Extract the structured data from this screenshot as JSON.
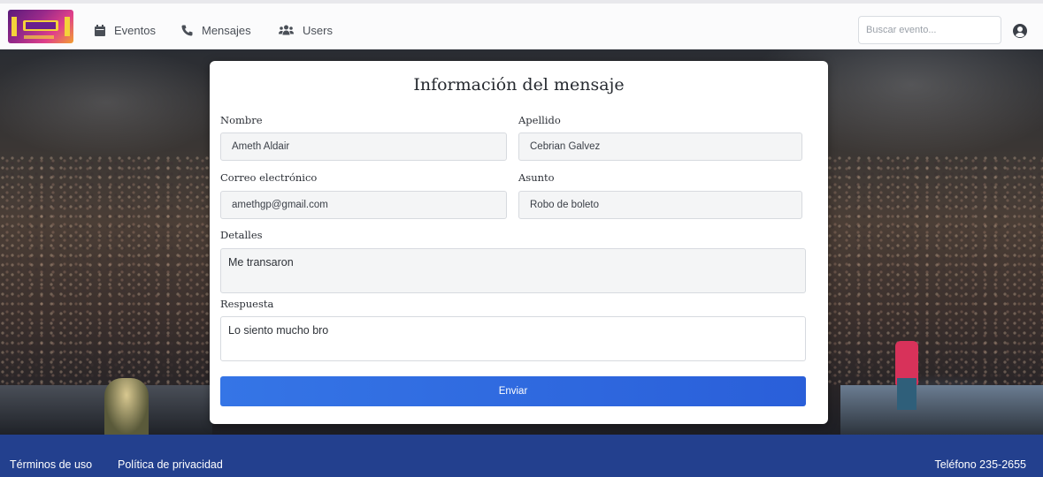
{
  "navbar": {
    "logo_alt": "Eventazo",
    "items": [
      {
        "label": "Eventos",
        "icon": "calendar-icon"
      },
      {
        "label": "Mensajes",
        "icon": "phone-icon"
      },
      {
        "label": "Users",
        "icon": "users-icon"
      }
    ],
    "search_placeholder": "Buscar evento...",
    "user_icon": "user-circle-icon"
  },
  "form": {
    "title": "Información del mensaje",
    "nombre_label": "Nombre",
    "nombre_value": "Ameth Aldair",
    "apellido_label": "Apellido",
    "apellido_value": "Cebrian Galvez",
    "correo_label": "Correo electrónico",
    "correo_value": "amethgp@gmail.com",
    "asunto_label": "Asunto",
    "asunto_value": "Robo de boleto",
    "detalles_label": "Detalles",
    "detalles_value": "Me transaron",
    "respuesta_label": "Respuesta",
    "respuesta_value": "Lo siento mucho bro",
    "submit_label": "Enviar"
  },
  "footer": {
    "terms_label": "Términos de uso",
    "privacy_label": "Política de privacidad",
    "phone_label": "Teléfono 235-2655"
  },
  "colors": {
    "footer_bg": "#23408e",
    "button_bg": "#3575e6"
  }
}
